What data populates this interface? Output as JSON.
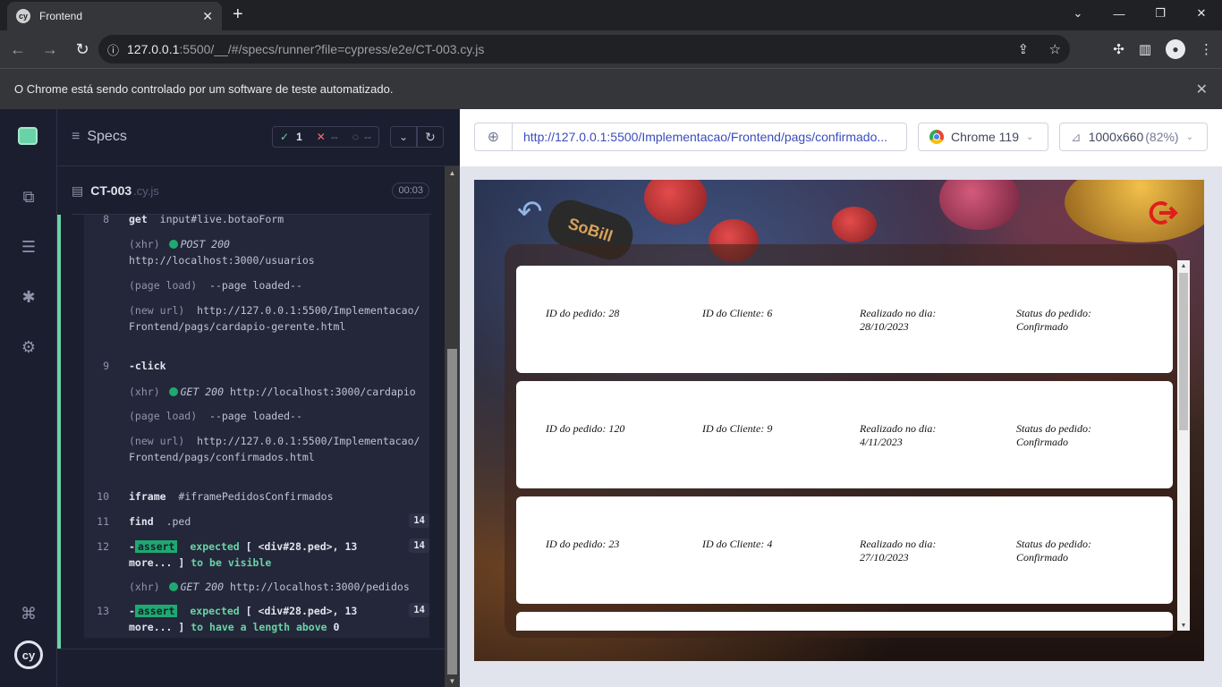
{
  "chrome": {
    "tab_title": "Frontend",
    "tab_favicon": "cy",
    "url_host": "127.0.0.1",
    "url_rest": ":5500/__/#/specs/runner?file=cypress/e2e/CT-003.cy.js",
    "infobar_text": "O Chrome está sendo controlado por um software de teste automatizado."
  },
  "reporter": {
    "specs_label": "Specs",
    "stats": {
      "passed": "1",
      "failed": "--",
      "pending": "--"
    },
    "spec": {
      "name": "CT-003",
      "ext": ".cy.js",
      "time": "00:03"
    },
    "commands": [
      {
        "num": "8",
        "name": "get",
        "detail": "input#live.botaoForm"
      },
      {
        "num": "",
        "prefix": "(xhr)",
        "method": "POST 200",
        "detail": "http://localhost:3000/usuarios"
      },
      {
        "num": "",
        "prefix": "(page load)",
        "detail": "--page loaded--"
      },
      {
        "num": "",
        "prefix": "(new url)",
        "detail": "http://127.0.0.1:5500/Implementacao/Frontend/pags/cardapio-gerente.html"
      },
      {
        "num": "9",
        "name": "-click",
        "detail": ""
      },
      {
        "num": "",
        "prefix": "(xhr)",
        "method": "GET 200",
        "detail": "http://localhost:3000/cardapio"
      },
      {
        "num": "",
        "prefix": "(page load)",
        "detail": "--page loaded--"
      },
      {
        "num": "",
        "prefix": "(new url)",
        "detail": "http://127.0.0.1:5500/Implementacao/Frontend/pags/confirmados.html"
      },
      {
        "num": "10",
        "name": "iframe",
        "detail": "#iframePedidosConfirmados"
      },
      {
        "num": "11",
        "name": "find",
        "detail": ".ped",
        "badge": "14"
      },
      {
        "num": "12",
        "tag": "assert",
        "a": "expected",
        "b": "[ <div#28.ped>, 13 more... ]",
        "c": "to be",
        "d": "visible",
        "badge": "14"
      },
      {
        "num": "",
        "prefix": "(xhr)",
        "method": "GET 200",
        "detail": "http://localhost:3000/pedidos"
      },
      {
        "num": "13",
        "tag": "assert",
        "a": "expected",
        "b": "[ <div#28.ped>, 13 more... ]",
        "c": "to have a length above",
        "d": "0",
        "badge": "14"
      }
    ]
  },
  "aut": {
    "url": "http://127.0.0.1:5500/Implementacao/Frontend/pags/confirmado...",
    "browser": "Chrome 119",
    "viewport": "1000x660",
    "viewport_pct": "(82%)",
    "sign_text": "SoBill",
    "orders": [
      {
        "id_label": "ID do pedido: 28",
        "client_label": "ID do Cliente: 6",
        "date_label": "Realizado no dia:",
        "date": "28/10/2023",
        "status_label": "Status do pedido:",
        "status": "Confirmado"
      },
      {
        "id_label": "ID do pedido: 120",
        "client_label": "ID do Cliente: 9",
        "date_label": "Realizado no dia:",
        "date": "4/11/2023",
        "status_label": "Status do pedido:",
        "status": "Confirmado"
      },
      {
        "id_label": "ID do pedido: 23",
        "client_label": "ID do Cliente: 4",
        "date_label": "Realizado no dia:",
        "date": "27/10/2023",
        "status_label": "Status do pedido:",
        "status": "Confirmado"
      }
    ]
  },
  "colors": {
    "pass": "#69d3a7",
    "fail": "#f87171",
    "link": "#3c4cbe",
    "reporter_bg": "#1b1e2e"
  }
}
